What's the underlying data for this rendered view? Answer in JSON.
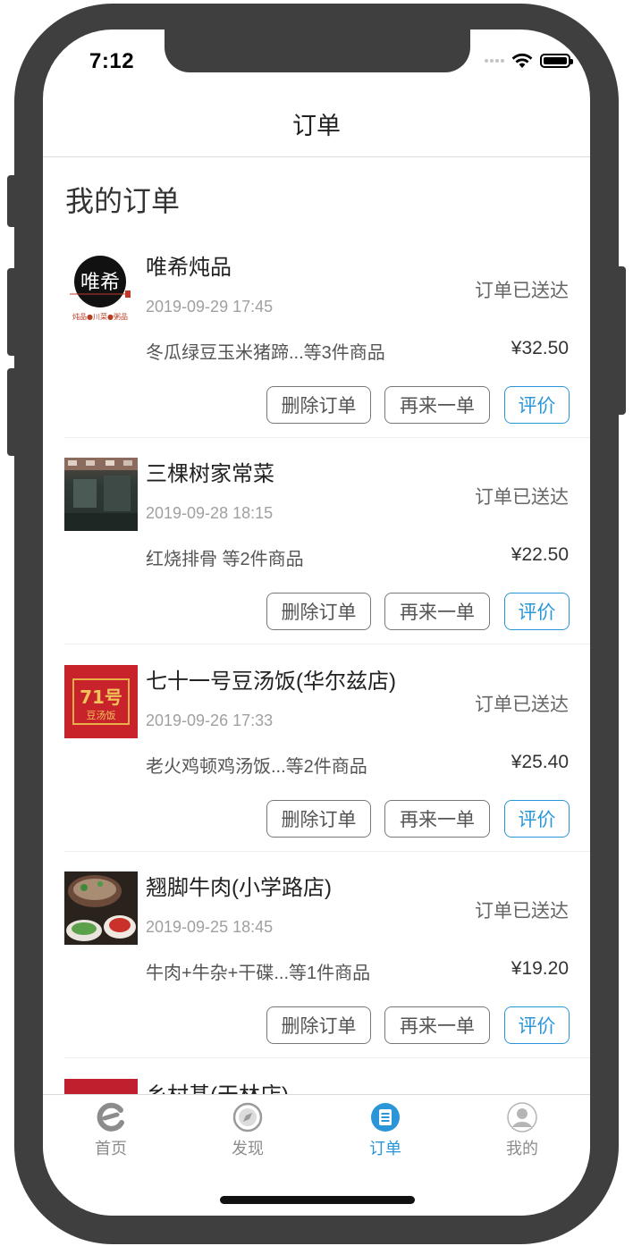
{
  "status_bar": {
    "time": "7:12"
  },
  "nav": {
    "title": "订单"
  },
  "section_title": "我的订单",
  "buttons": {
    "delete": "删除订单",
    "again": "再来一单",
    "rate": "评价"
  },
  "orders": [
    {
      "shop": "唯希炖品",
      "date": "2019-09-29 17:45",
      "status": "订单已送达",
      "items": "冬瓜绿豆玉米猪蹄...等3件商品",
      "price": "¥32.50",
      "logo_text": "唯希",
      "logo_sub": "炖品●川菜●粥品"
    },
    {
      "shop": "三棵树家常菜",
      "date": "2019-09-28 18:15",
      "status": "订单已送达",
      "items": "红烧排骨 等2件商品",
      "price": "¥22.50"
    },
    {
      "shop": "七十一号豆汤饭(华尔兹店)",
      "date": "2019-09-26 17:33",
      "status": "订单已送达",
      "items": "老火鸡顿鸡汤饭...等2件商品",
      "price": "¥25.40",
      "logo_text": "71号",
      "logo_sub": "豆汤饭"
    },
    {
      "shop": "翘脚牛肉(小学路店)",
      "date": "2019-09-25 18:45",
      "status": "订单已送达",
      "items": "牛肉+牛杂+干碟...等1件商品",
      "price": "¥19.20"
    },
    {
      "shop": "乡村基(天林店)"
    }
  ],
  "tabs": [
    {
      "label": "首页",
      "icon": "home-e-icon"
    },
    {
      "label": "发现",
      "icon": "compass-icon"
    },
    {
      "label": "订单",
      "icon": "order-list-icon",
      "active": true
    },
    {
      "label": "我的",
      "icon": "user-icon"
    }
  ],
  "colors": {
    "accent": "#2a96d8",
    "frame": "#3f3f3f"
  }
}
